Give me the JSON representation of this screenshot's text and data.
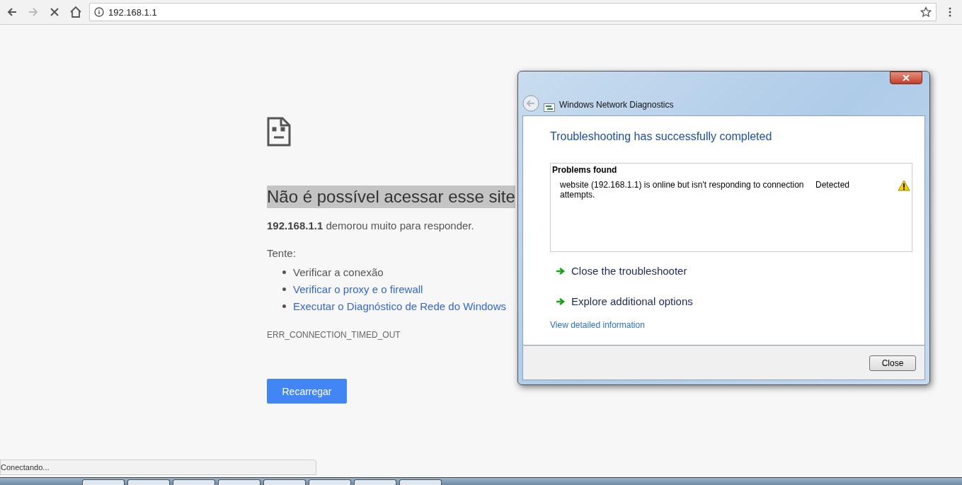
{
  "browser": {
    "address": "192.168.1.1",
    "loading": true
  },
  "error_page": {
    "heading": "Não é possível acessar esse site",
    "heading_highlighted": true,
    "message": "**192.168.1.1** demorou muito para responder.",
    "try_label": "Tente:",
    "suggestions": [
      {
        "kind": "text",
        "label": "Verificar a conexão"
      },
      {
        "kind": "link",
        "label": "Verificar o proxy e o firewall"
      },
      {
        "kind": "link",
        "label": "Executar o Diagnóstico de Rede do Windows"
      }
    ],
    "error_code": "ERR_CONNECTION_TIMED_OUT",
    "reload_button": "Recarregar"
  },
  "dialog": {
    "title": "Windows Network Diagnostics",
    "heading": "Troubleshooting has successfully completed",
    "problems_title": "Problems found",
    "problems": [
      {
        "description": "website (192.168.1.1) is online but isn't responding to connection attempts.",
        "status": "Detected"
      }
    ],
    "actions": [
      "Close the troubleshooter",
      "Explore additional options"
    ],
    "details_link": "View detailed information",
    "close_button": "Close"
  },
  "status_bubble": "Conectando..."
}
